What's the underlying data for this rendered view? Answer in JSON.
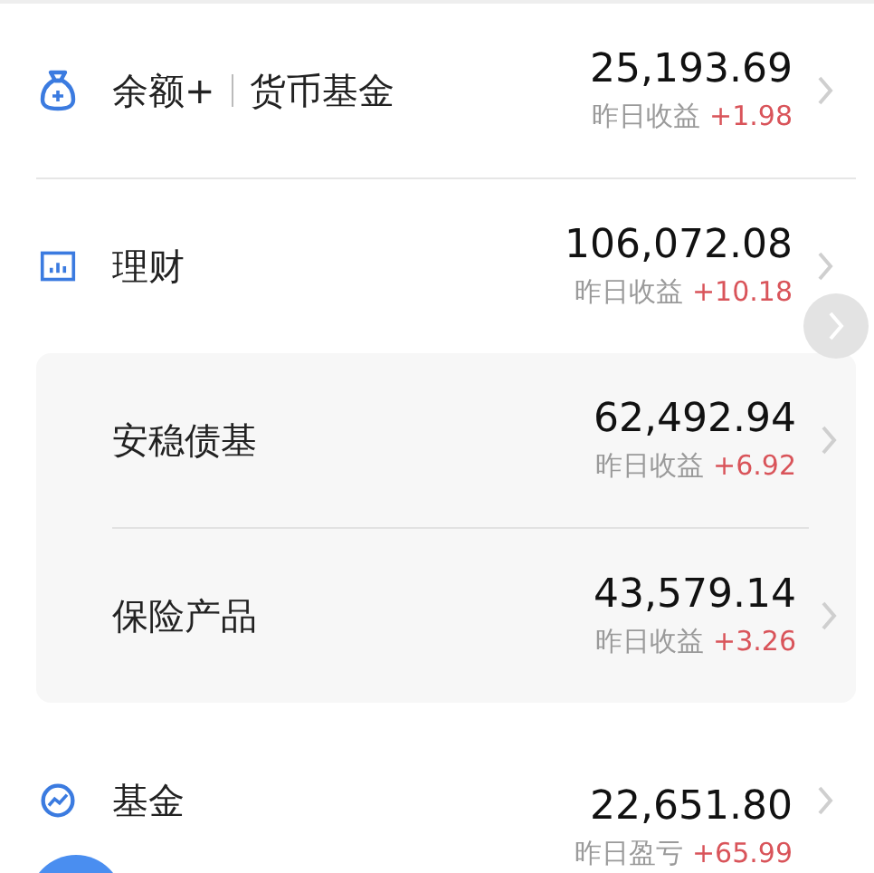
{
  "accounts": [
    {
      "kind": "bag",
      "label": "余额+",
      "sublabel": "货币基金",
      "amount": "25,193.69",
      "yield_label": "昨日收益",
      "yield": "+1.98"
    },
    {
      "kind": "chart",
      "label": "理财",
      "amount": "106,072.08",
      "yield_label": "昨日收益",
      "yield": "+10.18",
      "expanded": true,
      "children": [
        {
          "label": "安稳债基",
          "amount": "62,492.94",
          "yield_label": "昨日收益",
          "yield": "+6.92"
        },
        {
          "label": "保险产品",
          "amount": "43,579.14",
          "yield_label": "昨日收益",
          "yield": "+3.26"
        }
      ]
    },
    {
      "kind": "trend",
      "label": "基金",
      "amount": "22,651.80",
      "yield_label": "昨日盈亏",
      "yield": "+65.99"
    }
  ]
}
